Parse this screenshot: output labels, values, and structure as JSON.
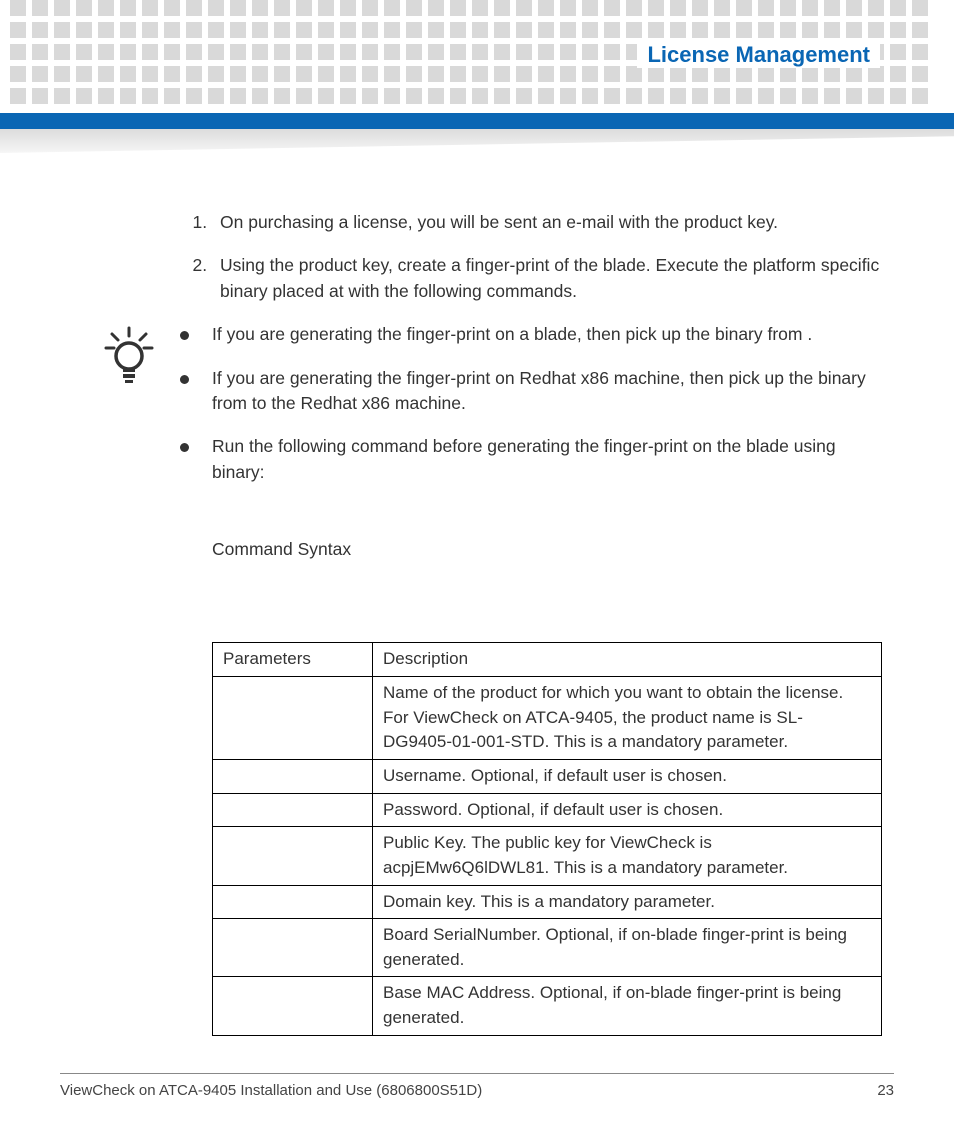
{
  "header": {
    "title": "License Management"
  },
  "steps": [
    "On purchasing a license, you will be sent an e-mail with the product key.",
    "Using the product key, create a finger-print of the blade. Execute the platform specific                                       binary placed at                                                                                          with the following commands."
  ],
  "tips": [
    "If you are generating the finger-print on a blade, then pick up the                                       binary from                                                                                                  .",
    "If you are generating the finger-print on Redhat x86 machine, then pick up the                                                           binary from                                                                          to the Redhat x86 machine.",
    "Run the following command before generating the finger-print on the blade using                                                     binary:"
  ],
  "command_syntax_label": "Command Syntax",
  "table": {
    "headers": [
      "Parameters",
      "Description"
    ],
    "rows": [
      [
        "",
        "Name of the product for which you want to obtain the license. For ViewCheck on ATCA-9405, the product name is SL-DG9405-01-001-STD. This is a mandatory parameter."
      ],
      [
        "",
        "Username. Optional, if default user is chosen."
      ],
      [
        "",
        "Password. Optional, if default user is chosen."
      ],
      [
        "",
        "Public Key. The public key for ViewCheck is acpjEMw6Q6lDWL81. This is a mandatory parameter."
      ],
      [
        "",
        "Domain key. This is a mandatory parameter."
      ],
      [
        "",
        "Board SerialNumber. Optional, if on-blade finger-print is being generated."
      ],
      [
        "",
        "Base MAC Address. Optional, if on-blade finger-print is being generated."
      ]
    ]
  },
  "footer": {
    "doc": "ViewCheck on ATCA-9405 Installation and Use (6806800S51D)",
    "page": "23"
  }
}
